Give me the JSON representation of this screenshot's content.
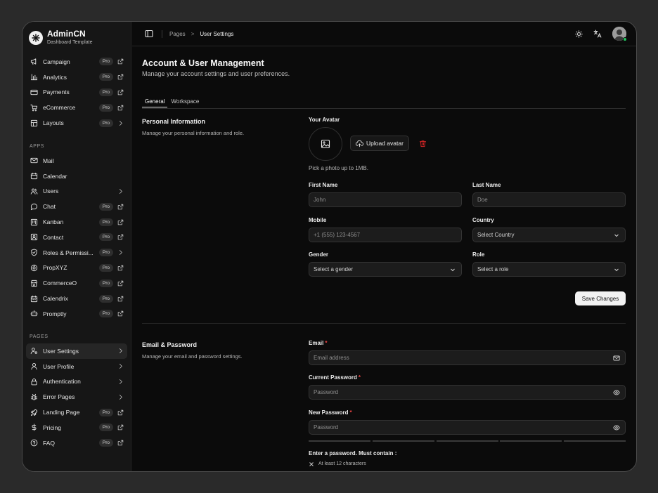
{
  "brand": {
    "name": "AdminCN",
    "subtitle": "Dashboard Template"
  },
  "sidebar": {
    "top_items": [
      {
        "label": "Campaign",
        "icon": "megaphone-icon",
        "badge": "Pro",
        "trail": "external-link-icon"
      },
      {
        "label": "Analytics",
        "icon": "bar-chart-icon",
        "badge": "Pro",
        "trail": "external-link-icon"
      },
      {
        "label": "Payments",
        "icon": "credit-card-icon",
        "badge": "Pro",
        "trail": "external-link-icon"
      },
      {
        "label": "eCommerce",
        "icon": "cart-icon",
        "badge": "Pro",
        "trail": "external-link-icon"
      },
      {
        "label": "Layouts",
        "icon": "layout-icon",
        "badge": "Pro",
        "trail": "chevron-right-icon"
      }
    ],
    "apps_heading": "APPS",
    "apps_items": [
      {
        "label": "Mail",
        "icon": "mail-icon"
      },
      {
        "label": "Calendar",
        "icon": "calendar-icon"
      },
      {
        "label": "Users",
        "icon": "users-icon",
        "trail": "chevron-right-icon"
      },
      {
        "label": "Chat",
        "icon": "chat-icon",
        "badge": "Pro",
        "trail": "external-link-icon"
      },
      {
        "label": "Kanban",
        "icon": "kanban-icon",
        "badge": "Pro",
        "trail": "external-link-icon"
      },
      {
        "label": "Contact",
        "icon": "contact-icon",
        "badge": "Pro",
        "trail": "external-link-icon"
      },
      {
        "label": "Roles & Permissi...",
        "icon": "shield-icon",
        "badge": "Pro",
        "trail": "chevron-right-icon"
      },
      {
        "label": "PropXYZ",
        "icon": "prop-icon",
        "badge": "Pro",
        "trail": "external-link-icon"
      },
      {
        "label": "CommerceO",
        "icon": "store-icon",
        "badge": "Pro",
        "trail": "external-link-icon"
      },
      {
        "label": "Calendrix",
        "icon": "calendrix-icon",
        "badge": "Pro",
        "trail": "external-link-icon"
      },
      {
        "label": "Promptly",
        "icon": "bot-icon",
        "badge": "Pro",
        "trail": "external-link-icon"
      }
    ],
    "pages_heading": "PAGES",
    "pages_items": [
      {
        "label": "User Settings",
        "icon": "user-cog-icon",
        "trail": "chevron-right-icon",
        "active": true
      },
      {
        "label": "User Profile",
        "icon": "user-icon",
        "trail": "chevron-right-icon"
      },
      {
        "label": "Authentication",
        "icon": "lock-icon",
        "trail": "chevron-right-icon"
      },
      {
        "label": "Error Pages",
        "icon": "bug-icon",
        "trail": "chevron-right-icon"
      },
      {
        "label": "Landing Page",
        "icon": "rocket-icon",
        "badge": "Pro",
        "trail": "external-link-icon"
      },
      {
        "label": "Pricing",
        "icon": "dollar-icon",
        "badge": "Pro",
        "trail": "external-link-icon"
      },
      {
        "label": "FAQ",
        "icon": "help-icon",
        "badge": "Pro",
        "trail": "external-link-icon"
      }
    ]
  },
  "topbar": {
    "crumb_root": "Pages",
    "crumb_sep": ">",
    "crumb_current": "User Settings"
  },
  "page": {
    "title": "Account & User Management",
    "subtitle": "Manage your account settings and user preferences."
  },
  "tabs": [
    {
      "label": "General",
      "active": true
    },
    {
      "label": "Workspace",
      "active": false
    }
  ],
  "personal": {
    "title": "Personal Information",
    "subtitle": "Manage your personal information and role.",
    "avatar_label": "Your Avatar",
    "upload_label": "Upload avatar",
    "avatar_hint": "Pick a photo up to 1MB.",
    "first_name_label": "First Name",
    "first_name_placeholder": "John",
    "last_name_label": "Last Name",
    "last_name_placeholder": "Doe",
    "mobile_label": "Mobile",
    "mobile_placeholder": "+1 (555) 123-4567",
    "country_label": "Country",
    "country_value": "Select Country",
    "gender_label": "Gender",
    "gender_placeholder": "Select a gender",
    "role_label": "Role",
    "role_placeholder": "Select a role",
    "save_label": "Save Changes"
  },
  "security": {
    "title": "Email & Password",
    "subtitle": "Manage your email and password settings.",
    "email_label": "Email",
    "email_placeholder": "Email address",
    "current_password_label": "Current Password",
    "current_password_placeholder": "Password",
    "new_password_label": "New Password",
    "new_password_placeholder": "Password",
    "required_mark": "*",
    "rules_title": "Enter a password. Must contain :",
    "rule_1": "At least 12 characters"
  },
  "colors": {
    "background": "#0b0b0b",
    "sidebar": "#161616",
    "required": "#ef4444",
    "delete": "#dc2626",
    "online": "#22c55e"
  }
}
